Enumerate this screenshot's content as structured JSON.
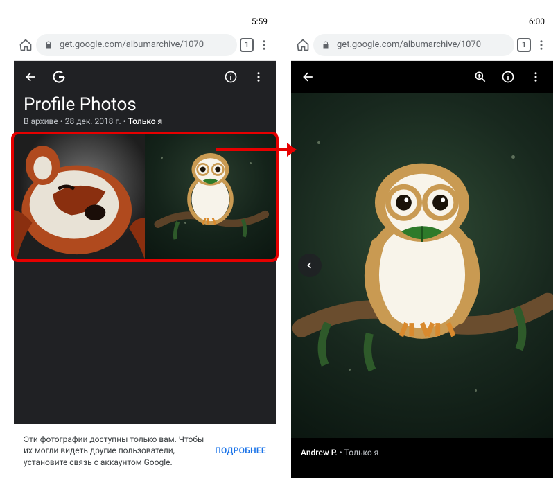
{
  "left": {
    "status_time": "5:59",
    "url": "get.google.com/albumarchive/1070",
    "tab_count": "1",
    "title": "Profile Photos",
    "meta_archived": "В архиве",
    "meta_sep1": " • ",
    "meta_date": "28 дек. 2018 г.",
    "meta_sep2": " • ",
    "meta_privacy": "Только я",
    "banner_text": "Эти фотографии доступны только вам. Чтобы их могли видеть другие пользователи, установите связь с аккаунтом Google.",
    "banner_link": "ПОДРОБНЕЕ",
    "thumbs": {
      "t0_name": "red-panda-photo",
      "t1_name": "owl-illustration"
    }
  },
  "right": {
    "status_time": "6:00",
    "url": "get.google.com/albumarchive/1070",
    "tab_count": "1",
    "author": "Andrew P.",
    "meta_sep": " • ",
    "privacy": "Только я"
  }
}
